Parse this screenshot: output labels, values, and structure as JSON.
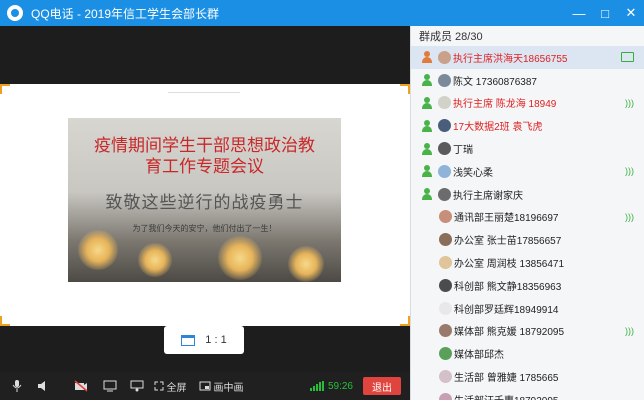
{
  "window": {
    "title": "QQ电话 - 2019年信工学生会部长群",
    "controls": {
      "minimize": "—",
      "maximize": "□",
      "close": "✕"
    }
  },
  "slide": {
    "title_line1": "疫情期间学生干部思想政治教",
    "title_line2": "育工作专题会议",
    "calligraphy": "致敬这些逆行的战疫勇士",
    "subtitle": "为了我们今天的安宁，他们付出了一生！"
  },
  "ratio": {
    "label": "1 : 1"
  },
  "toolbar": {
    "fullscreen_label": "全屏",
    "pip_label": "画中画",
    "time": "59:26",
    "exit_label": "退出"
  },
  "members": {
    "header": "群成员 28/30",
    "list": [
      {
        "name": "执行主席洪海天18656755",
        "red": true,
        "avatar_color": "#c9a08a",
        "status": "share",
        "indent": false,
        "host": true,
        "selected": true
      },
      {
        "name": "陈文 17360876387",
        "red": false,
        "avatar_color": "#7a8a9a",
        "status": "",
        "indent": false,
        "host": false,
        "selected": false
      },
      {
        "name": "执行主席 陈龙海 18949",
        "red": true,
        "avatar_color": "#d2d2c8",
        "status": "sound",
        "indent": false,
        "host": false,
        "selected": false
      },
      {
        "name": "17大数据2班 袁飞虎",
        "red": true,
        "avatar_color": "#4a5d7a",
        "status": "",
        "indent": false,
        "host": false,
        "selected": false
      },
      {
        "name": "丁瑞",
        "red": false,
        "avatar_color": "#5a5a5a",
        "status": "",
        "indent": false,
        "host": false,
        "selected": false
      },
      {
        "name": "浅笑心柔",
        "red": false,
        "avatar_color": "#8fb4d8",
        "status": "sound",
        "indent": false,
        "host": false,
        "selected": false
      },
      {
        "name": "执行主席谢家庆",
        "red": false,
        "avatar_color": "#6c6c6c",
        "status": "",
        "indent": false,
        "host": false,
        "selected": false
      },
      {
        "name": "通讯部王丽楚18196697",
        "red": false,
        "avatar_color": "#c78e7a",
        "status": "sound",
        "indent": true,
        "host": false,
        "selected": false
      },
      {
        "name": "办公室 张士苗17856657",
        "red": false,
        "avatar_color": "#8a6e5a",
        "status": "",
        "indent": true,
        "host": false,
        "selected": false
      },
      {
        "name": "办公室 周润枝 13856471",
        "red": false,
        "avatar_color": "#e0c49a",
        "status": "",
        "indent": true,
        "host": false,
        "selected": false
      },
      {
        "name": "科创部 熊文静18356963",
        "red": false,
        "avatar_color": "#4c4c4c",
        "status": "",
        "indent": true,
        "host": false,
        "selected": false
      },
      {
        "name": "科创部罗廷辉18949914",
        "red": false,
        "avatar_color": "#e8e8e8",
        "status": "",
        "indent": true,
        "host": false,
        "selected": false
      },
      {
        "name": "媒体部 熊克媛 18792095",
        "red": false,
        "avatar_color": "#9a7a6a",
        "status": "sound",
        "indent": true,
        "host": false,
        "selected": false
      },
      {
        "name": "媒体部邱杰",
        "red": false,
        "avatar_color": "#5aa05a",
        "status": "",
        "indent": true,
        "host": false,
        "selected": false
      },
      {
        "name": "生活部 曾雅婕 1785665",
        "red": false,
        "avatar_color": "#d4c0c8",
        "status": "",
        "indent": true,
        "host": false,
        "selected": false
      },
      {
        "name": "生活部汪千惠18792095",
        "red": false,
        "avatar_color": "#c8a0b4",
        "status": "",
        "indent": true,
        "host": false,
        "selected": false
      }
    ]
  },
  "colors": {
    "titlebar": "#1a8fe3",
    "accent_green": "#34b03a",
    "exit_red": "#e0443e",
    "highlight_red": "#e02020"
  }
}
